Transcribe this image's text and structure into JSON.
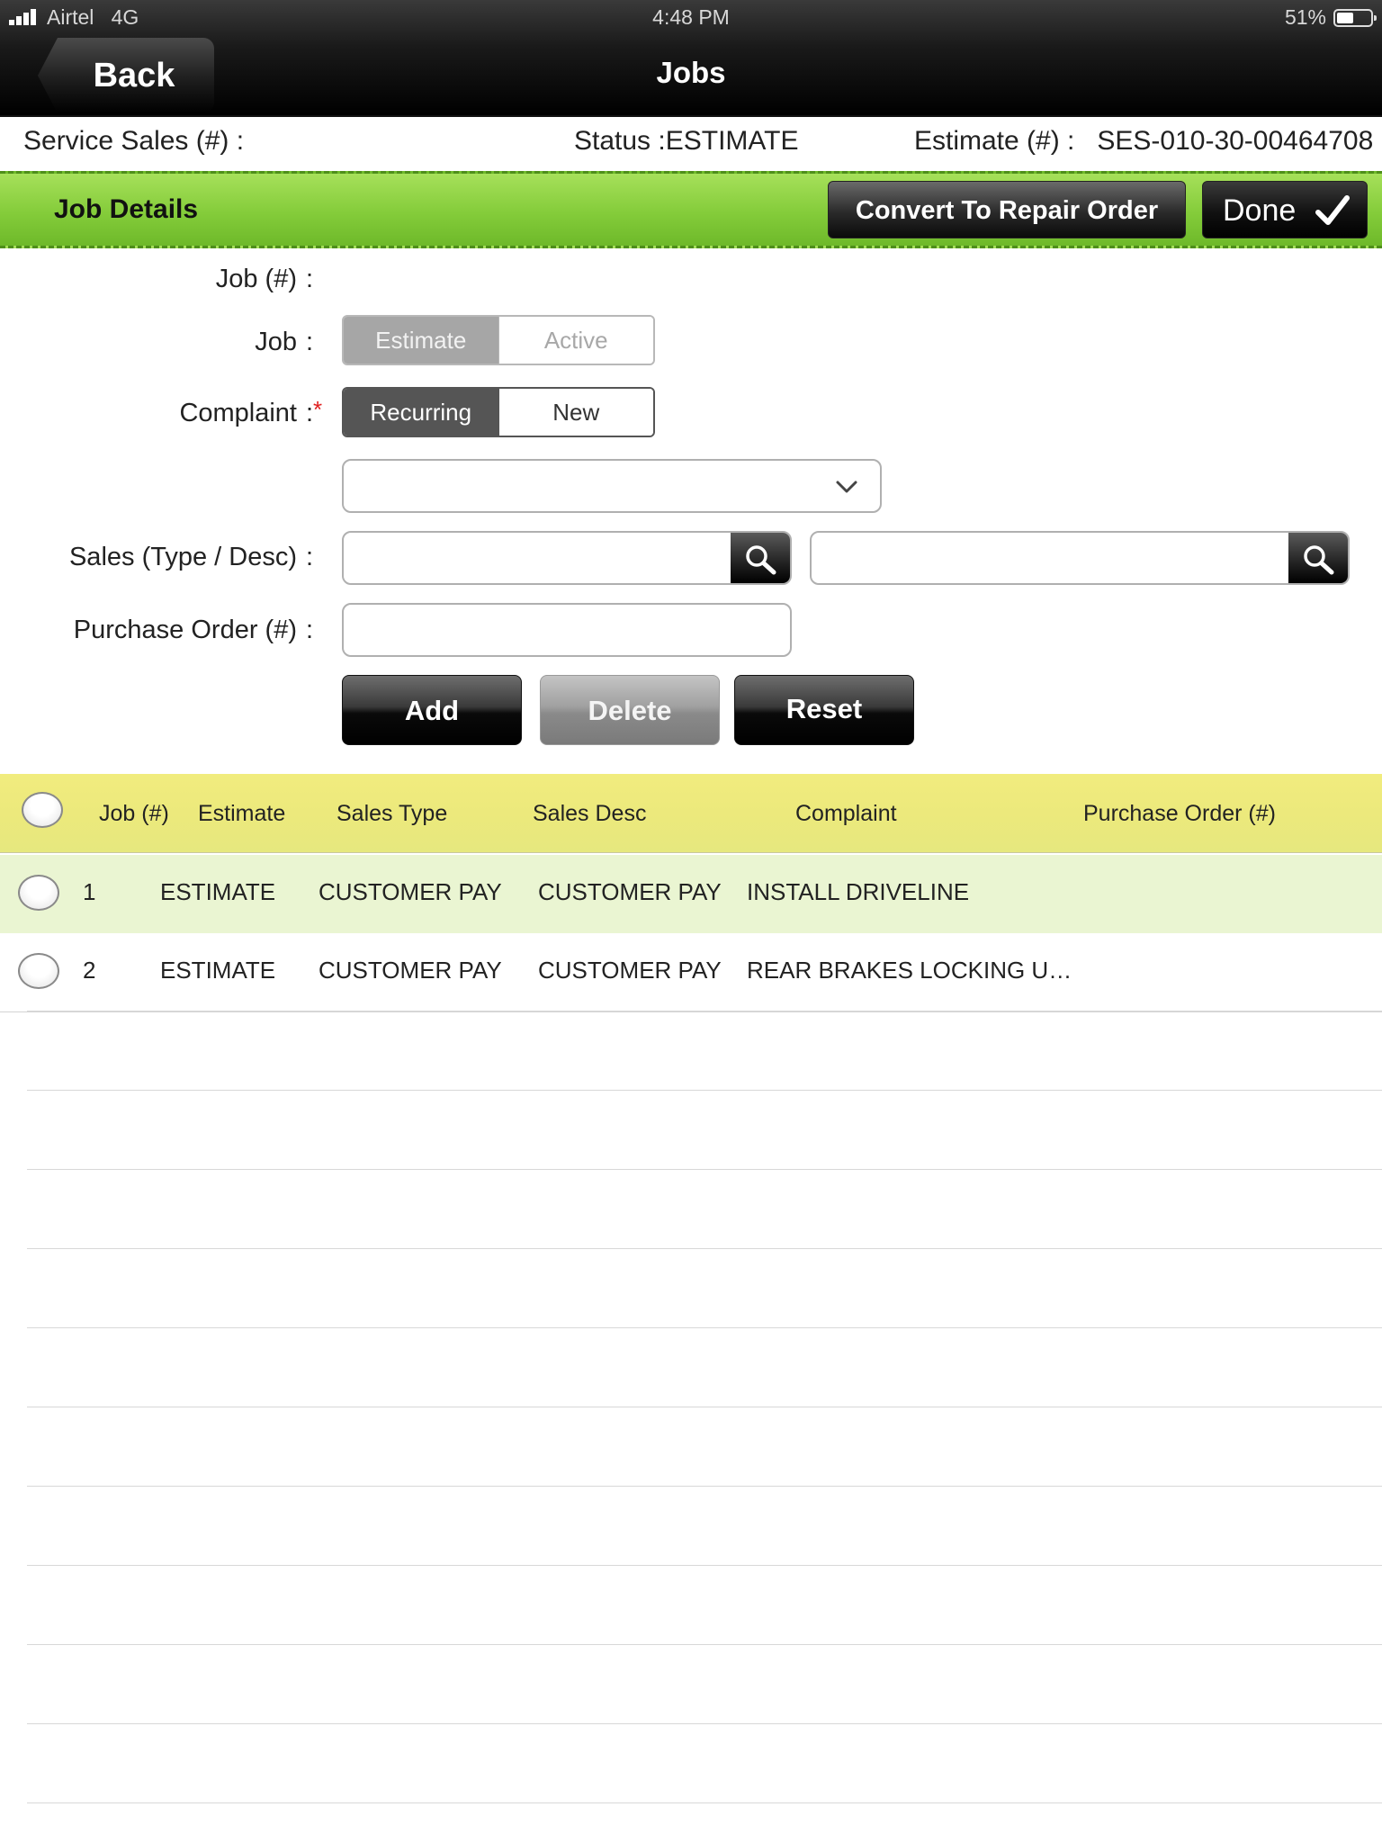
{
  "status_bar": {
    "carrier": "Airtel",
    "network": "4G",
    "time": "4:48 PM",
    "battery": "51%"
  },
  "nav": {
    "back_label": "Back",
    "title": "Jobs"
  },
  "info": {
    "service_sales": "Service Sales (#)  :",
    "status": "Status :ESTIMATE",
    "estimate": "Estimate (#) :   SES-010-30-00464708"
  },
  "details_bar": {
    "title": "Job Details",
    "convert_label": "Convert To Repair Order",
    "done_label": "Done"
  },
  "form": {
    "job_number_label": "Job (#)",
    "job_label": "Job",
    "job_segments": [
      "Estimate",
      "Active"
    ],
    "complaint_label": "Complaint",
    "complaint_segments": [
      "Recurring",
      "New"
    ],
    "required_mark": "*",
    "sales_label": "Sales (Type / Desc)",
    "po_label": "Purchase Order (#)",
    "colon": ":"
  },
  "actions": {
    "add_label": "Add",
    "delete_label": "Delete",
    "reset_label": "Reset"
  },
  "table": {
    "headers": [
      "Job (#)",
      "Estimate",
      "Sales Type",
      "Sales Desc",
      "Complaint",
      "Purchase Order (#)"
    ],
    "rows": [
      {
        "job": "1",
        "estimate": "ESTIMATE",
        "sales_type": "CUSTOMER PAY",
        "sales_desc": "CUSTOMER PAY",
        "complaint": "INSTALL DRIVELINE",
        "po": ""
      },
      {
        "job": "2",
        "estimate": "ESTIMATE",
        "sales_type": "CUSTOMER PAY",
        "sales_desc": "CUSTOMER PAY",
        "complaint": "REAR BRAKES LOCKING U…",
        "po": ""
      }
    ]
  },
  "colors": {
    "green_bar": "#84cc3a",
    "header_yellow": "#ece97c",
    "selected_row": "#eaf5d2",
    "required": "#e02020"
  },
  "icons": [
    "signal-icon",
    "battery-icon",
    "check-icon",
    "chevron-down-icon",
    "search-icon"
  ]
}
